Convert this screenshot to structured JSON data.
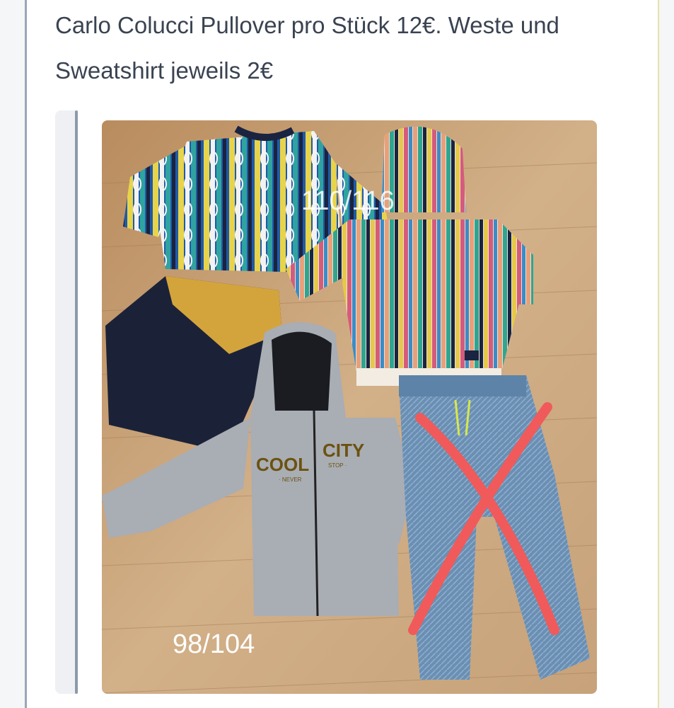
{
  "post": {
    "text": "Carlo Colucci Pullover pro Stück 12€. Weste und Sweatshirt jeweils 2€"
  },
  "photo": {
    "label_top": "110/116",
    "label_bottom": "98/104",
    "print_cool": "COOL",
    "print_city": "CITY",
    "print_never": "· NEVER",
    "print_stop": "STOP ·"
  },
  "colors": {
    "floor": "#c9a57a",
    "strike": "#f05a5a",
    "gutter": "#9aa6b8",
    "text": "#3a4351"
  }
}
